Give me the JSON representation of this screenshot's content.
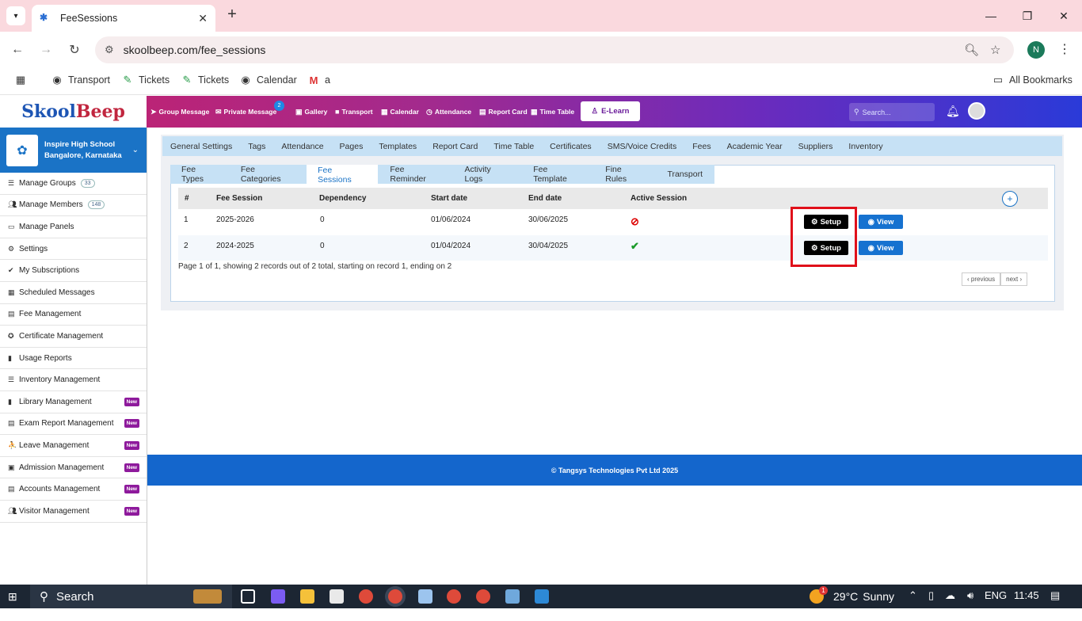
{
  "browser": {
    "tab_title": "FeeSessions",
    "url": "skoolbeep.com/fee_sessions",
    "profile_initial": "N",
    "bookmarks": [
      "Transport",
      "Tickets",
      "Tickets",
      "Calendar",
      "a"
    ],
    "all_bookmarks": "All Bookmarks"
  },
  "header": {
    "logo_a": "Skool",
    "logo_b": "Beep",
    "nav": [
      "Group Message",
      "Private Message",
      "Gallery",
      "Transport",
      "Calendar",
      "Attendance",
      "Report Card",
      "Time Table"
    ],
    "private_badge": "2",
    "elearn": "E-Learn",
    "search_placeholder": "Search..."
  },
  "sidebar": {
    "school_name": "Inspire High School",
    "school_location": "Bangalore, Karnataka",
    "items": [
      {
        "label": "Manage Groups",
        "count": "33"
      },
      {
        "label": "Manage Members",
        "count": "148"
      },
      {
        "label": "Manage Panels"
      },
      {
        "label": "Settings"
      },
      {
        "label": "My Subscriptions"
      },
      {
        "label": "Scheduled Messages"
      },
      {
        "label": "Fee Management"
      },
      {
        "label": "Certificate Management"
      },
      {
        "label": "Usage Reports"
      },
      {
        "label": "Inventory Management"
      },
      {
        "label": "Library Management",
        "badge": "New"
      },
      {
        "label": "Exam Report Management",
        "badge": "New"
      },
      {
        "label": "Leave Management",
        "badge": "New"
      },
      {
        "label": "Admission Management",
        "badge": "New"
      },
      {
        "label": "Accounts Management",
        "badge": "New"
      },
      {
        "label": "Visitor Management",
        "badge": "New"
      }
    ]
  },
  "settings_tabs": [
    "General Settings",
    "Tags",
    "Attendance",
    "Pages",
    "Templates",
    "Report Card",
    "Time Table",
    "Certificates",
    "SMS/Voice Credits",
    "Fees",
    "Academic Year",
    "Suppliers",
    "Inventory"
  ],
  "fee_tabs": [
    "Fee Types",
    "Fee Categories",
    "Fee Sessions",
    "Fee Reminder",
    "Activity Logs",
    "Fee Template",
    "Fine Rules",
    "Transport"
  ],
  "fee_tab_active": "Fee Sessions",
  "table": {
    "columns": [
      "#",
      "Fee Session",
      "Dependency",
      "Start date",
      "End date",
      "Active Session"
    ],
    "rows": [
      {
        "num": "1",
        "session": "2025-2026",
        "dependency": "0",
        "start": "01/06/2024",
        "end": "30/06/2025",
        "active": false
      },
      {
        "num": "2",
        "session": "2024-2025",
        "dependency": "0",
        "start": "01/04/2024",
        "end": "30/04/2025",
        "active": true
      }
    ],
    "setup_label": "Setup",
    "view_label": "View",
    "plus_label": "+"
  },
  "pager": {
    "summary": "Page 1 of 1, showing 2 records out of 2 total, starting on record 1, ending on 2",
    "previous": "‹ previous",
    "next": "next ›"
  },
  "footer": "© Tangsys Technologies Pvt Ltd 2025",
  "taskbar": {
    "search": "Search",
    "temperature": "29°C",
    "weather": "Sunny",
    "lang": "ENG",
    "time": "11:45",
    "weather_badge": "1"
  },
  "colors": {
    "header_gradient_start": "#c8206a",
    "header_gradient_end": "#2a3ad8",
    "sidebar_school": "#1a73c6",
    "tab_bar": "#c6e1f5",
    "footer": "#1466cc",
    "highlight": "#e0101a"
  }
}
